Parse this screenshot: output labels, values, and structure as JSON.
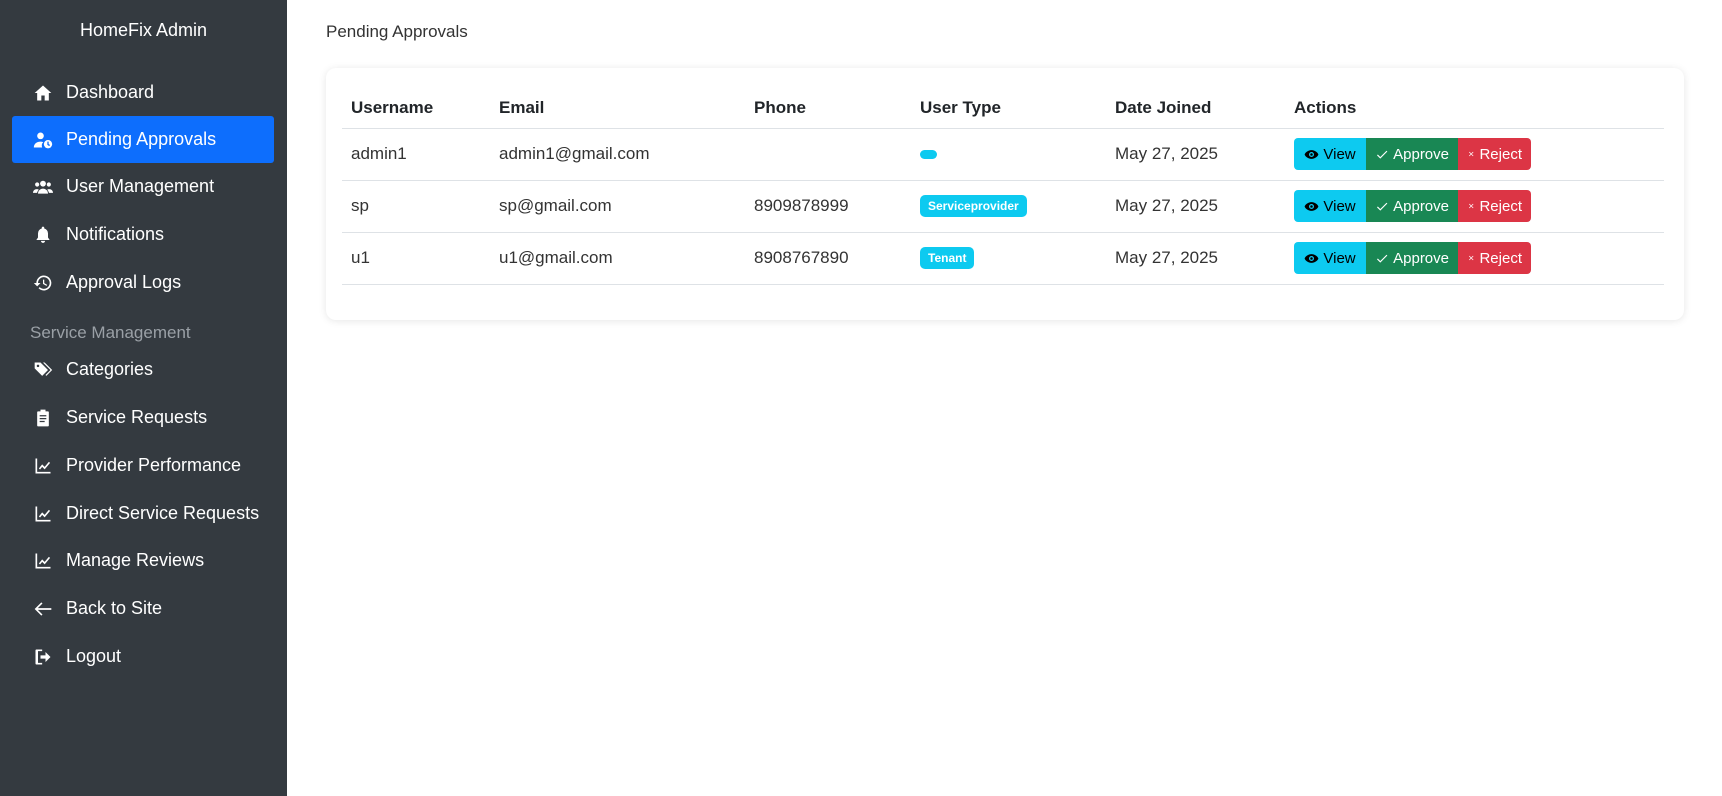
{
  "sidebar": {
    "brand": "HomeFix Admin",
    "items": [
      {
        "label": "Dashboard",
        "icon": "home-icon"
      },
      {
        "label": "Pending Approvals",
        "icon": "user-clock-icon",
        "active": true
      },
      {
        "label": "User Management",
        "icon": "users-icon"
      },
      {
        "label": "Notifications",
        "icon": "bell-icon"
      },
      {
        "label": "Approval Logs",
        "icon": "history-icon"
      }
    ],
    "section_label": "Service Management",
    "service_items": [
      {
        "label": "Categories",
        "icon": "tags-icon"
      },
      {
        "label": "Service Requests",
        "icon": "clipboard-icon"
      },
      {
        "label": "Provider Performance",
        "icon": "chart-line-icon"
      },
      {
        "label": "Direct Service Requests",
        "icon": "chart-line-icon"
      },
      {
        "label": "Manage Reviews",
        "icon": "chart-line-icon"
      },
      {
        "label": "Back to Site",
        "icon": "arrow-left-icon"
      },
      {
        "label": "Logout",
        "icon": "sign-out-icon"
      }
    ]
  },
  "main": {
    "title": "Pending Approvals",
    "table": {
      "headers": [
        "Username",
        "Email",
        "Phone",
        "User Type",
        "Date Joined",
        "Actions"
      ],
      "rows": [
        {
          "username": "admin1",
          "email": "admin1@gmail.com",
          "phone": "",
          "user_type": "",
          "date_joined": "May 27, 2025"
        },
        {
          "username": "sp",
          "email": "sp@gmail.com",
          "phone": "8909878999",
          "user_type": "Serviceprovider",
          "date_joined": "May 27, 2025"
        },
        {
          "username": "u1",
          "email": "u1@gmail.com",
          "phone": "8908767890",
          "user_type": "Tenant",
          "date_joined": "May 27, 2025"
        }
      ],
      "actions": {
        "view": "View",
        "approve": "Approve",
        "reject": "Reject"
      }
    }
  },
  "colors": {
    "sidebar_bg": "#343a40",
    "active": "#0d6efd",
    "info": "#0dcaf0",
    "success": "#198754",
    "danger": "#dc3545"
  }
}
